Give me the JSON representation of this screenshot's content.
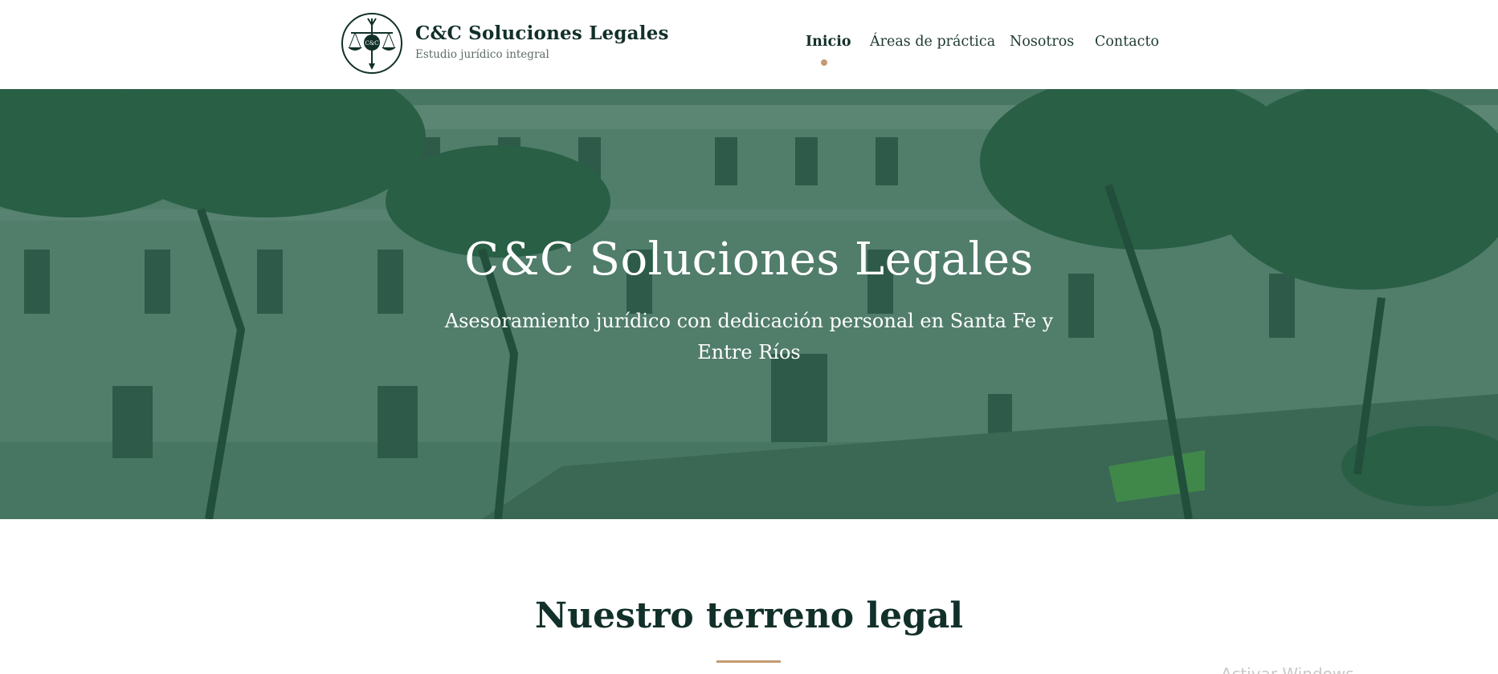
{
  "brand": {
    "title": "C&C Soluciones Legales",
    "subtitle": "Estudio jurídico integral",
    "logo_text": "C&C",
    "logo_icon": "scales-of-justice-icon"
  },
  "nav": {
    "items": [
      {
        "label": "Inicio",
        "active": true
      },
      {
        "label": "Áreas de práctica",
        "active": false
      },
      {
        "label": "Nosotros",
        "active": false
      },
      {
        "label": "Contacto",
        "active": false
      }
    ]
  },
  "hero": {
    "title": "C&C Soluciones Legales",
    "subtitle": "Asesoramiento jurídico con dedicación personal en Santa Fe y Entre Ríos"
  },
  "section": {
    "title": "Nuestro terreno legal"
  },
  "watermark": "Activar Windows",
  "colors": {
    "primary": "#12302a",
    "accent": "#c49a72",
    "overlay": "#1c5840"
  }
}
